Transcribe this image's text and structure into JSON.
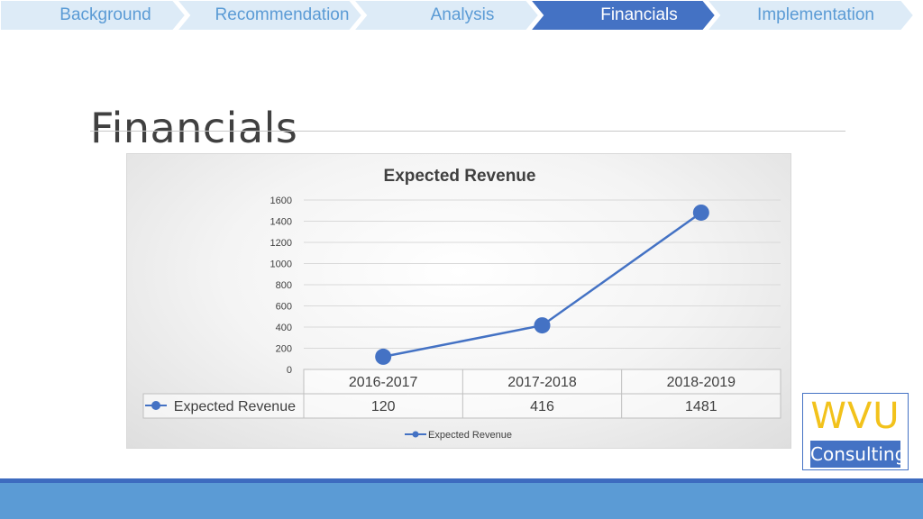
{
  "nav": {
    "items": [
      {
        "label": "Background",
        "active": false
      },
      {
        "label": "Recommendation",
        "active": false
      },
      {
        "label": "Analysis",
        "active": false
      },
      {
        "label": "Financials",
        "active": true
      },
      {
        "label": "Implementation",
        "active": false
      }
    ],
    "colors": {
      "inactive_fill": "#ddebf7",
      "active_fill": "#4472c4",
      "inactive_text": "#5b9bd5",
      "active_text": "#ffffff"
    }
  },
  "page": {
    "title": "Financials"
  },
  "chart_data": {
    "type": "line",
    "title": "Expected Revenue",
    "categories": [
      "2016-2017",
      "2017-2018",
      "2018-2019"
    ],
    "series": [
      {
        "name": "Expected Revenue",
        "values": [
          120,
          416,
          1481
        ],
        "color": "#4472c4"
      }
    ],
    "ylim": [
      0,
      1600
    ],
    "yticks": [
      0,
      200,
      400,
      600,
      800,
      1000,
      1200,
      1400,
      1600
    ],
    "grid": true,
    "data_table": true,
    "legend": "bottom"
  },
  "logo": {
    "top_text": "WVU",
    "bottom_text": "Consulting",
    "accent": "#f2c21b"
  },
  "footer": {
    "color": "#5b9bd5",
    "line_color": "#3d6bbf"
  }
}
